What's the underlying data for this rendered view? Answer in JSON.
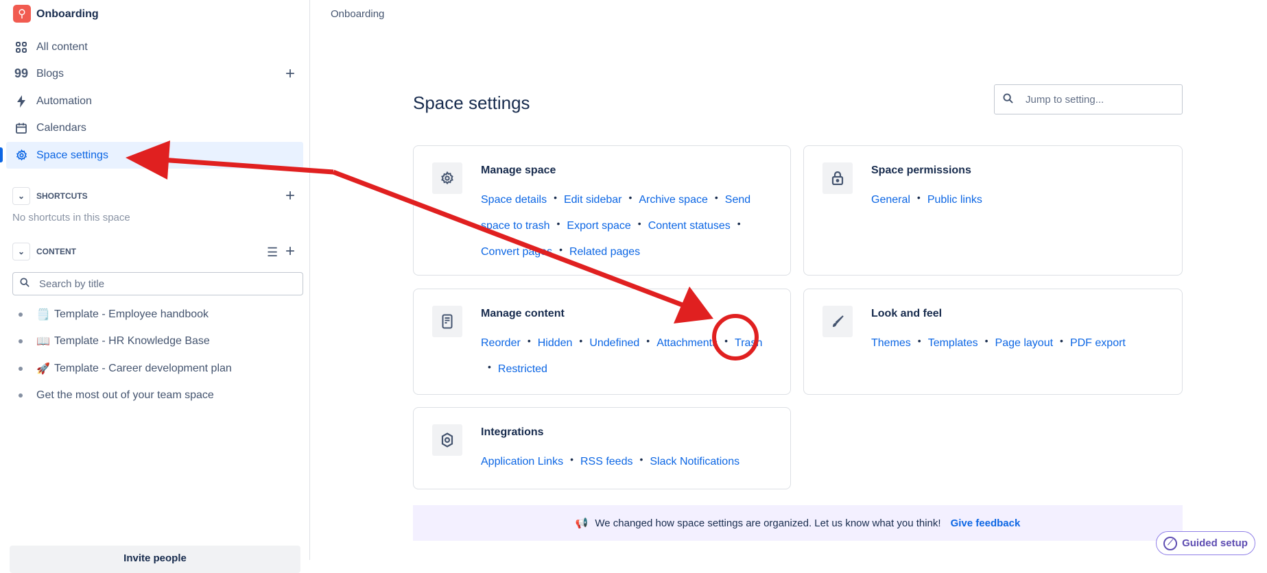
{
  "sidebar": {
    "space_name": "Onboarding",
    "nav": [
      {
        "label": "All content",
        "icon": "grid-icon"
      },
      {
        "label": "Blogs",
        "icon": "quote-icon"
      },
      {
        "label": "Automation",
        "icon": "lightning-icon"
      },
      {
        "label": "Calendars",
        "icon": "calendar-icon"
      },
      {
        "label": "Space settings",
        "icon": "gear-icon",
        "active": true
      }
    ],
    "shortcuts_label": "SHORTCUTS",
    "shortcuts_empty": "No shortcuts in this space",
    "content_label": "CONTENT",
    "search_placeholder": "Search by title",
    "tree": [
      {
        "emoji": "🗒️",
        "label": "Template - Employee handbook"
      },
      {
        "emoji": "📖",
        "label": "Template - HR Knowledge Base"
      },
      {
        "emoji": "🚀",
        "label": "Template - Career development plan"
      },
      {
        "emoji": "",
        "label": "Get the most out of your team space"
      }
    ],
    "invite_label": "Invite people"
  },
  "breadcrumb": "Onboarding",
  "main": {
    "title": "Space settings",
    "jump_placeholder": "Jump to setting...",
    "cards": [
      {
        "title": "Manage space",
        "icon": "gear-icon",
        "links": [
          "Space details",
          "Edit sidebar",
          "Archive space",
          "Send space to trash",
          "Export space",
          "Content statuses",
          "Convert pages",
          "Related pages"
        ]
      },
      {
        "title": "Space permissions",
        "icon": "lock-icon",
        "links": [
          "General",
          "Public links"
        ]
      },
      {
        "title": "Manage content",
        "icon": "document-icon",
        "links": [
          "Reorder",
          "Hidden",
          "Undefined",
          "Attachments",
          "Trash",
          "Restricted"
        ]
      },
      {
        "title": "Look and feel",
        "icon": "brush-icon",
        "links": [
          "Themes",
          "Templates",
          "Page layout",
          "PDF export"
        ]
      },
      {
        "title": "Integrations",
        "icon": "hexagon-icon",
        "links": [
          "Application Links",
          "RSS feeds",
          "Slack Notifications"
        ]
      }
    ],
    "banner": {
      "text": "We changed how space settings are organized. Let us know what you think!",
      "link": "Give feedback",
      "icon": "megaphone-icon"
    },
    "guided_setup": "Guided setup"
  },
  "annotation_color": "#e02020",
  "colors": {
    "link": "#0c66e4",
    "active_bg": "#e9f2ff",
    "banner_bg": "#f3f0ff"
  }
}
